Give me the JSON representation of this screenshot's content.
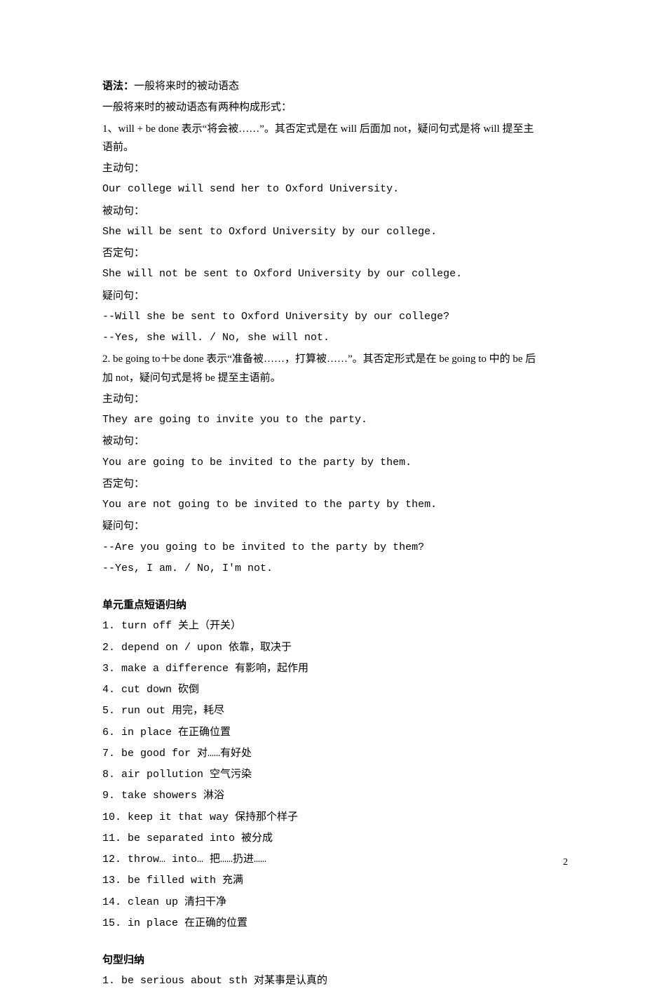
{
  "grammar": {
    "title_prefix": "语法：",
    "title_text": "一般将来时的被动语态",
    "intro": "一般将来时的被动语态有两种构成形式：",
    "rule1": "1、will + be done 表示“将会被……”。其否定式是在 will 后面加 not，疑问句式是将 will 提至主语前。",
    "active_label": "主动句：",
    "passive_label": "被动句：",
    "neg_label": "否定句：",
    "q_label": "疑问句：",
    "r1_active": "Our college will send her to Oxford University.",
    "r1_passive": "She will be sent to Oxford University by our college.",
    "r1_neg": "She will not be sent to Oxford University by our college.",
    "r1_q": "--Will she be sent to Oxford University by our college?",
    "r1_a": "--Yes, she will. / No, she will not.",
    "rule2": "2. be going to＋be done 表示“准备被……，打算被……”。其否定形式是在 be going to 中的 be 后加 not，疑问句式是将 be 提至主语前。",
    "r2_active": "They are going to invite you to the party.",
    "r2_passive": "You are going to be invited to the party by them.",
    "r2_neg": "You are not going to be invited to the party by them.",
    "r2_q": "--Are you going to be invited to the party by them?",
    "r2_a": "--Yes, I am. / No, I'm not."
  },
  "phrases": {
    "heading": "单元重点短语归纳",
    "items": [
      "1. turn off   关上（开关）",
      "2. depend on / upon   依靠，取决于",
      "3. make a difference   有影响，起作用",
      "4. cut down   砍倒",
      "5. run out   用完，耗尽",
      "6. in place   在正确位置",
      "7. be good for   对……有好处",
      "8. air pollution   空气污染",
      "9. take showers   淋浴",
      "10. keep it that way   保持那个样子",
      "11. be separated into   被分成",
      "12. throw… into…   把……扔进……",
      "13. be filled with   充满",
      "14. clean up   清扫干净",
      "15. in place   在正确的位置"
    ]
  },
  "sentences": {
    "heading": "句型归纳",
    "items": [
      "1. be serious about sth   对某事是认真的"
    ]
  },
  "page_number": "2"
}
